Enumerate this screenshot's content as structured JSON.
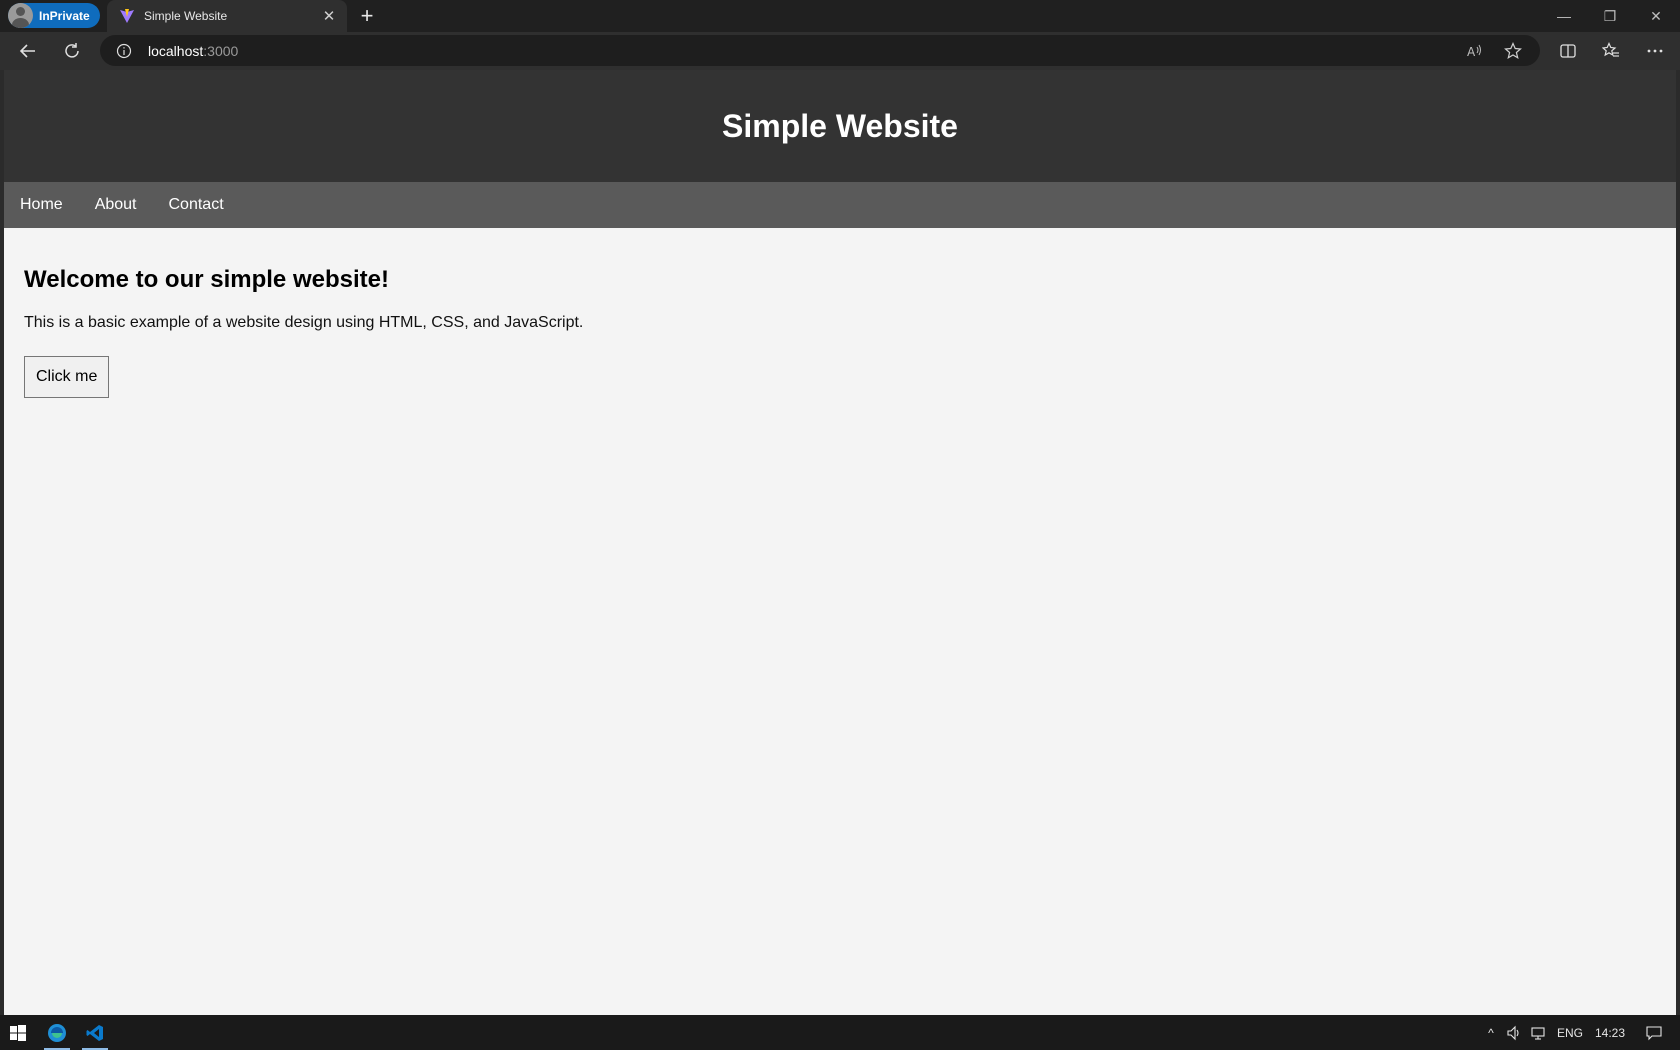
{
  "browser": {
    "inprivate_label": "InPrivate",
    "tab": {
      "title": "Simple Website"
    },
    "address": {
      "host": "localhost",
      "port": ":3000"
    }
  },
  "page": {
    "header_title": "Simple Website",
    "nav": [
      "Home",
      "About",
      "Contact"
    ],
    "heading": "Welcome to our simple website!",
    "paragraph": "This is a basic example of a website design using HTML, CSS, and JavaScript.",
    "button_label": "Click me"
  },
  "taskbar": {
    "language": "ENG",
    "time": "14:23"
  },
  "colors": {
    "header_bg": "#333333",
    "nav_bg": "#5a5a5a",
    "page_bg": "#f4f4f4",
    "inprivate_accent": "#0f6cbd"
  }
}
